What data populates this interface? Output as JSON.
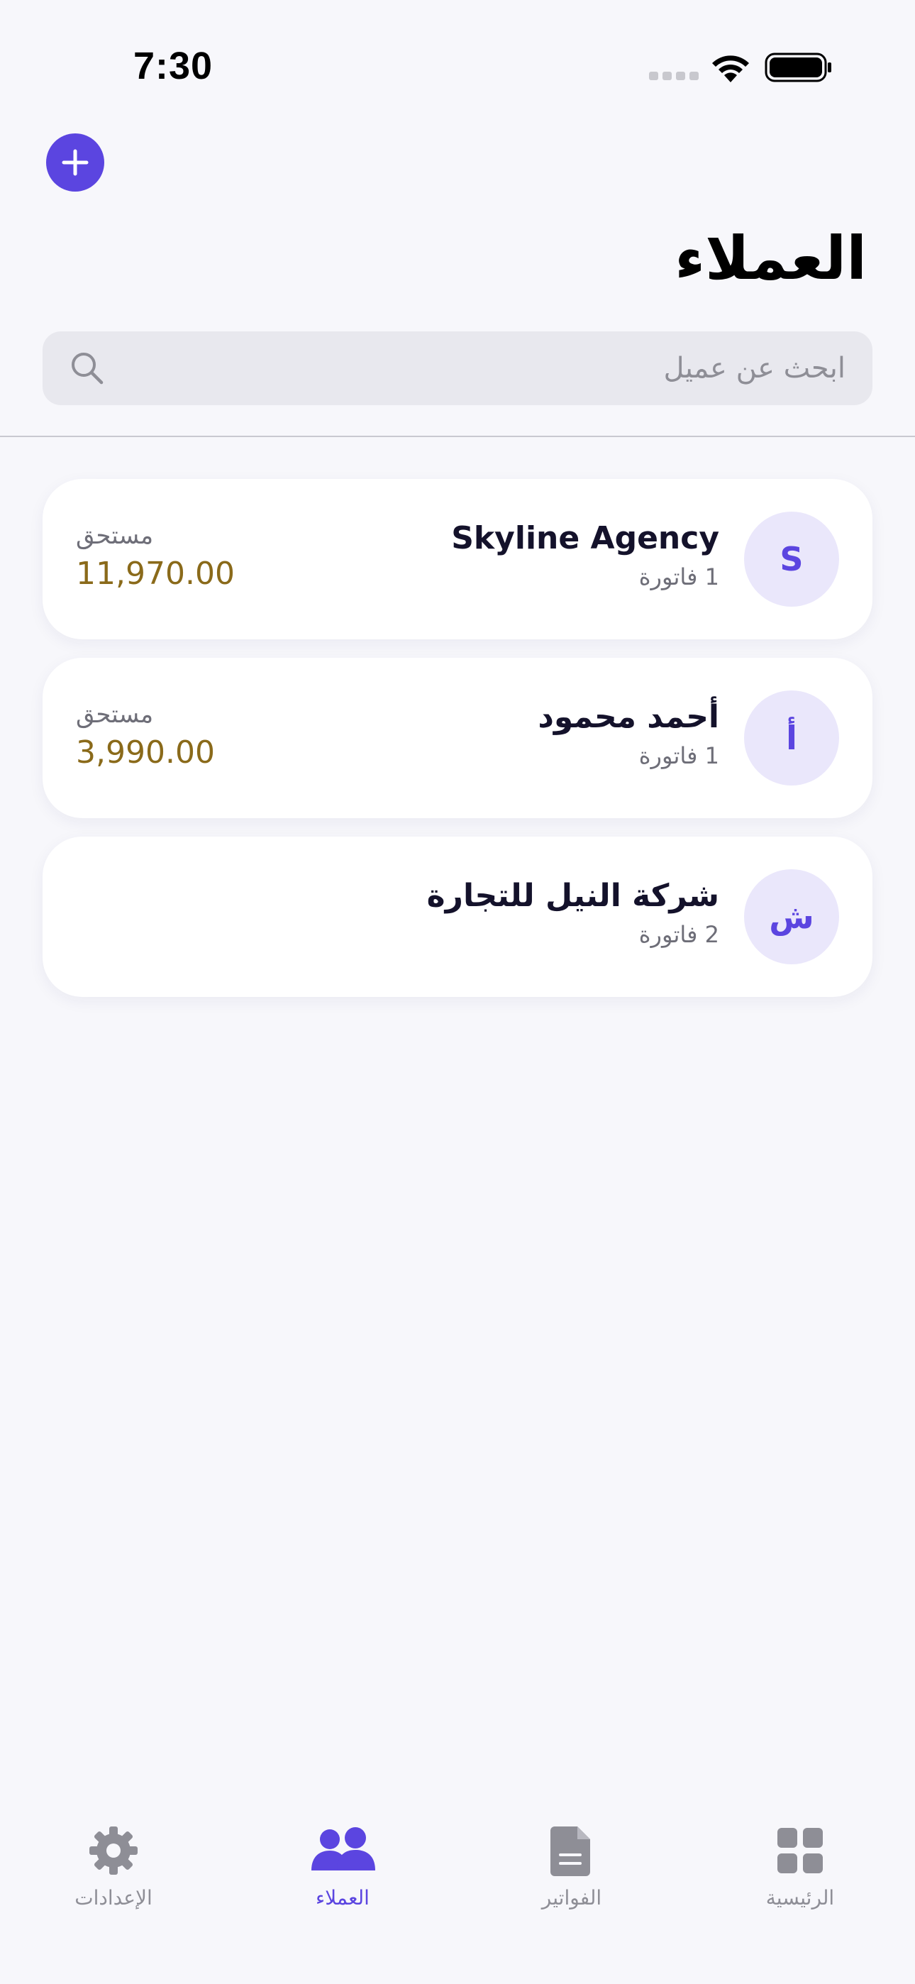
{
  "status_bar": {
    "time": "7:30"
  },
  "header": {
    "title": "العملاء",
    "search_placeholder": "ابحث عن عميل"
  },
  "colors": {
    "accent": "#5B45E0",
    "avatar_bg": "#EAE7FB",
    "due_amount": "#8A6A1A",
    "background": "#F7F7FB"
  },
  "clients": [
    {
      "initial": "S",
      "name": "Skyline Agency",
      "invoices": "1 فاتورة",
      "due_label": "مستحق",
      "due_amount": "11,970.00"
    },
    {
      "initial": "أ",
      "name": "أحمد محمود",
      "invoices": "1 فاتورة",
      "due_label": "مستحق",
      "due_amount": "3,990.00"
    },
    {
      "initial": "ش",
      "name": "شركة النيل للتجارة",
      "invoices": "2 فاتورة"
    }
  ],
  "tabs": [
    {
      "label": "الإعدادات",
      "icon": "gear-icon"
    },
    {
      "label": "العملاء",
      "icon": "people-icon",
      "active": true
    },
    {
      "label": "الفواتير",
      "icon": "document-icon"
    },
    {
      "label": "الرئيسية",
      "icon": "grid-icon"
    }
  ]
}
